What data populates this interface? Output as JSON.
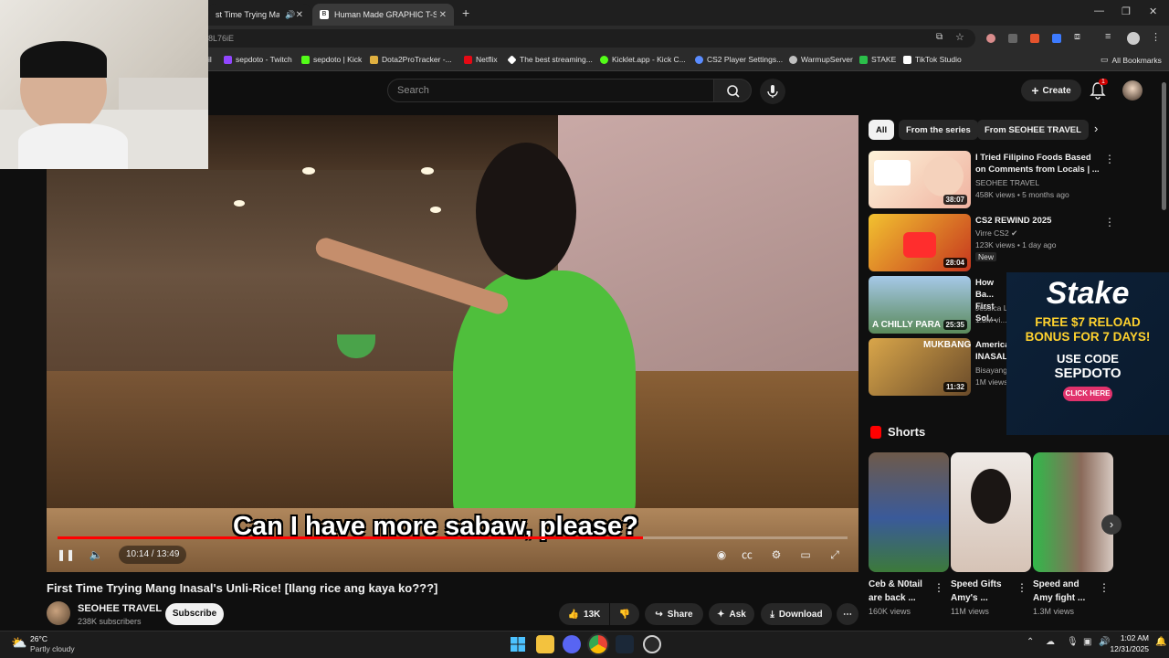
{
  "browser": {
    "tabs": [
      {
        "label": "st Time Trying Mang I",
        "active": false
      },
      {
        "label": "Human Made GRAPHIC T-SHIR",
        "active": true
      }
    ],
    "new_tab_symbol": "+",
    "url": "8L76iE",
    "bookmarks": [
      {
        "label": "il",
        "color": "#ff4d4d"
      },
      {
        "label": "sepdoto - Twitch",
        "color": "#9146ff"
      },
      {
        "label": "sepdoto | Kick",
        "color": "#53fc18"
      },
      {
        "label": "Dota2ProTracker -...",
        "color": "#e0b040"
      },
      {
        "label": "Netflix",
        "color": "#e50914"
      },
      {
        "label": "The best streaming...",
        "color": "#ffffff"
      },
      {
        "label": "Kicklet.app - Kick C...",
        "color": "#53fc18"
      },
      {
        "label": "CS2 Player Settings...",
        "color": "#5a8cff"
      },
      {
        "label": "WarmupServer",
        "color": "#c0c0c0"
      },
      {
        "label": "STAKE",
        "color": "#2bbf4a"
      },
      {
        "label": "TikTok Studio",
        "color": "#ffffff"
      }
    ],
    "all_bookmarks": "All Bookmarks"
  },
  "youtube": {
    "search_placeholder": "Search",
    "create_label": "Create",
    "notif_count": "1",
    "player": {
      "caption": "Can I have more sabaw, please?",
      "timecode": "10:14 / 13:49",
      "progress_fraction": 0.741
    },
    "video": {
      "title": "First Time Trying Mang Inasal's Unli-Rice! [Ilang rice ang kaya ko???]",
      "channel": "SEOHEE TRAVEL",
      "subscribers": "238K subscribers",
      "subscribe_label": "Subscribe",
      "likes": "13K",
      "share_label": "Share",
      "ask_label": "Ask",
      "download_label": "Download"
    },
    "chips": [
      "All",
      "From the series",
      "From SEOHEE TRAVEL"
    ],
    "recommendations": [
      {
        "title": "I Tried Filipino Foods Based on Comments from Locals | ...",
        "channel": "SEOHEE TRAVEL",
        "meta": "458K views • 5 months ago",
        "duration": "38:07",
        "badge": ""
      },
      {
        "title": "CS2 REWIND 2025",
        "channel": "Virre CS2",
        "meta": "123K views • 1 day ago",
        "duration": "28:04",
        "badge": "New"
      },
      {
        "title": "How Ba... First Sol...",
        "channel": "Jessica L...",
        "meta": "1.3M vi...",
        "duration": "25:35",
        "badge": ""
      },
      {
        "title": "America... INASAL",
        "channel": "Bisayang...",
        "meta": "1M views",
        "duration": "11:32",
        "badge": ""
      }
    ],
    "thumb_texts": {
      "chilly": "A CHILLY PARA",
      "mukbang": "MUKBANG"
    },
    "ad": {
      "brand": "Stake",
      "line1": "FREE $7 RELOAD",
      "line2": "BONUS FOR 7 DAYS!",
      "line3": "USE CODE",
      "code": "SEPDOTO",
      "cta": "CLICK HERE"
    },
    "shorts_title": "Shorts",
    "shorts": [
      {
        "title": "Ceb & N0tail are back ...",
        "views": "160K views"
      },
      {
        "title": "Speed Gifts Amy's ...",
        "views": "11M views"
      },
      {
        "title": "Speed and Amy fight ...",
        "views": "1.3M views"
      }
    ]
  },
  "taskbar": {
    "weather_temp": "26°C",
    "weather_desc": "Partly cloudy",
    "time": "1:02 AM",
    "date": "12/31/2025"
  }
}
